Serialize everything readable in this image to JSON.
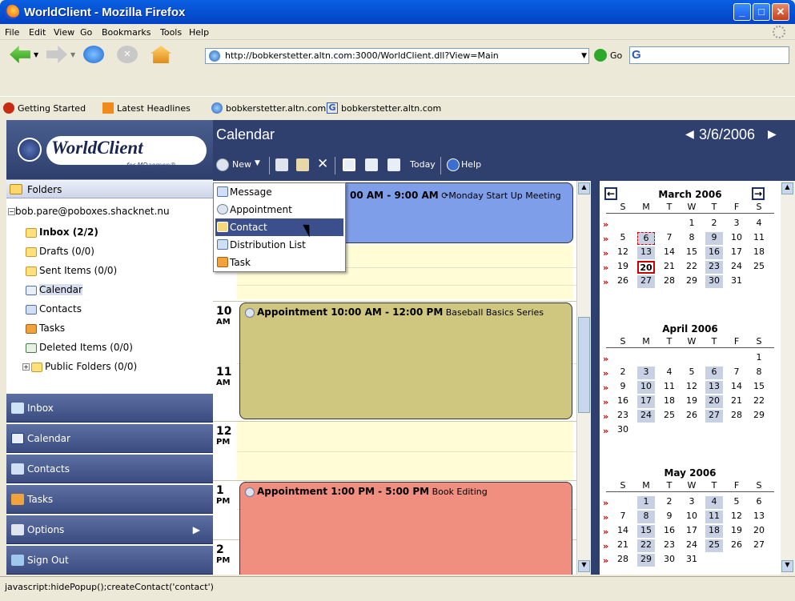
{
  "window": {
    "title": "WorldClient - Mozilla Firefox"
  },
  "menubar": [
    "File",
    "Edit",
    "View",
    "Go",
    "Bookmarks",
    "Tools",
    "Help"
  ],
  "navbar": {
    "url": "http://bobkerstetter.altn.com:3000/WorldClient.dll?View=Main",
    "go_label": "Go"
  },
  "bookmarks": [
    "Getting Started",
    "Latest Headlines",
    "bobkerstetter.altn.com",
    "bobkerstetter.altn.com"
  ],
  "app": {
    "logo_text": "WorldClient",
    "logo_sub": "for MDaemon®",
    "folders_header": "Folders",
    "account": "bob.pare@poboxes.shacknet.nu",
    "folders": [
      {
        "label": "Inbox (2/2)",
        "bold": true
      },
      {
        "label": "Drafts (0/0)"
      },
      {
        "label": "Sent Items (0/0)"
      },
      {
        "label": "Calendar"
      },
      {
        "label": "Contacts"
      },
      {
        "label": "Tasks"
      },
      {
        "label": "Deleted Items (0/0)"
      },
      {
        "label": "Public Folders (0/0)"
      }
    ],
    "nav_buttons": [
      "Inbox",
      "Calendar",
      "Contacts",
      "Tasks",
      "Options",
      "Sign Out"
    ]
  },
  "calendar": {
    "title": "Calendar",
    "date": "3/6/2006",
    "toolbar": {
      "new": "New",
      "today": "Today",
      "help": "Help"
    },
    "hours": [
      {
        "h": "10",
        "ampm": "AM"
      },
      {
        "h": "11",
        "ampm": "AM"
      },
      {
        "h": "12",
        "ampm": "PM"
      },
      {
        "h": "1",
        "ampm": "PM"
      },
      {
        "h": "2",
        "ampm": "PM"
      }
    ],
    "appointments": [
      {
        "time": "00 AM - 9:00 AM",
        "title": "Monday Start Up Meeting",
        "color": "#7f9ee9"
      },
      {
        "time": "Appointment 10:00 AM - 12:00 PM",
        "title": "Baseball Basics Series",
        "color": "#cfc67f"
      },
      {
        "time": "Appointment 1:00 PM - 5:00 PM",
        "title": "Book Editing",
        "color": "#f08f80"
      }
    ]
  },
  "new_menu": [
    "Message",
    "Appointment",
    "Contact",
    "Distribution List",
    "Task"
  ],
  "minical": {
    "day_headers": [
      "S",
      "M",
      "T",
      "W",
      "T",
      "F",
      "S"
    ],
    "months": [
      {
        "title": "March 2006",
        "weeks": [
          [
            "",
            "",
            "",
            "1",
            "2",
            "3",
            "4"
          ],
          [
            "5",
            "6",
            "7",
            "8",
            "9",
            "10",
            "11"
          ],
          [
            "12",
            "13",
            "14",
            "15",
            "16",
            "17",
            "18"
          ],
          [
            "19",
            "20",
            "21",
            "22",
            "23",
            "24",
            "25"
          ],
          [
            "26",
            "27",
            "28",
            "29",
            "30",
            "31",
            ""
          ]
        ]
      },
      {
        "title": "April 2006",
        "weeks": [
          [
            "",
            "",
            "",
            "",
            "",
            "",
            "1"
          ],
          [
            "2",
            "3",
            "4",
            "5",
            "6",
            "7",
            "8"
          ],
          [
            "9",
            "10",
            "11",
            "12",
            "13",
            "14",
            "15"
          ],
          [
            "16",
            "17",
            "18",
            "19",
            "20",
            "21",
            "22"
          ],
          [
            "23",
            "24",
            "25",
            "26",
            "27",
            "28",
            "29"
          ],
          [
            "30",
            "",
            "",
            "",
            "",
            "",
            ""
          ]
        ]
      },
      {
        "title": "May 2006",
        "weeks": [
          [
            "",
            "1",
            "2",
            "3",
            "4",
            "5",
            "6"
          ],
          [
            "7",
            "8",
            "9",
            "10",
            "11",
            "12",
            "13"
          ],
          [
            "14",
            "15",
            "16",
            "17",
            "18",
            "19",
            "20"
          ],
          [
            "21",
            "22",
            "23",
            "24",
            "25",
            "26",
            "27"
          ],
          [
            "28",
            "29",
            "30",
            "31",
            "",
            "",
            ""
          ]
        ]
      }
    ],
    "week_marker": "»"
  },
  "status": "javascript:hidePopup();createContact('contact')",
  "colors": {
    "accent": "#2f3f6e",
    "highlight": "#3b4f8c"
  }
}
